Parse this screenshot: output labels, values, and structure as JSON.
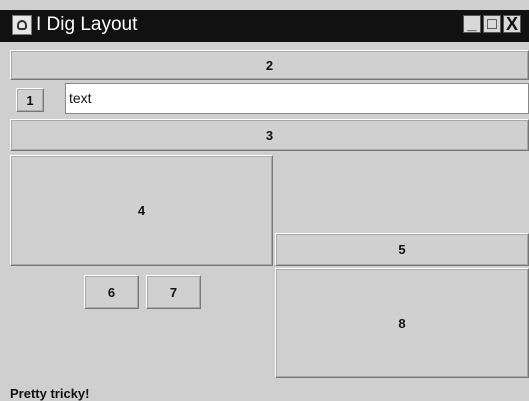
{
  "window": {
    "title": "I Dig Layout",
    "controls": {
      "minimize": "_",
      "maximize": "□",
      "close": "X"
    }
  },
  "buttons": {
    "b1": "1",
    "b2": "2",
    "b3": "3",
    "b4": "4",
    "b5": "5",
    "b6": "6",
    "b7": "7",
    "b8": "8"
  },
  "text_field": {
    "value": "text"
  },
  "status": "Pretty tricky!",
  "colors": {
    "titlebar": "#111111",
    "panel": "#cfcfcf",
    "desktop": "#b9cfe3",
    "field": "#ffffff"
  }
}
